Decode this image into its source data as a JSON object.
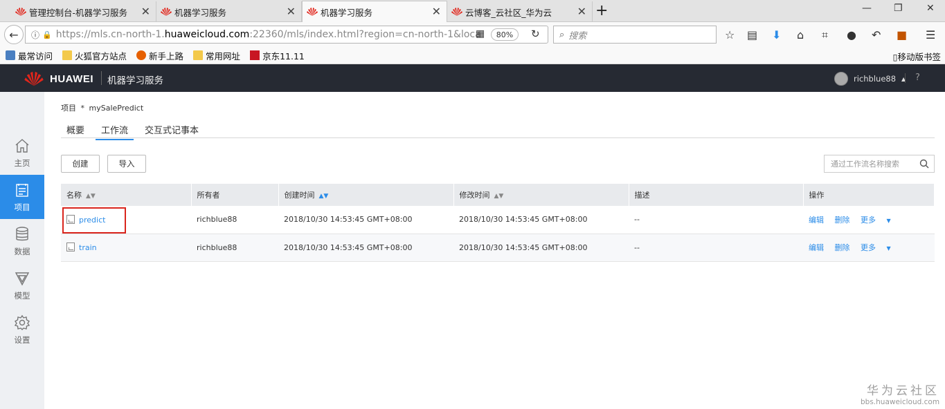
{
  "browser": {
    "tabs": [
      {
        "label": "管理控制台-机器学习服务",
        "active": false
      },
      {
        "label": "机器学习服务",
        "active": false
      },
      {
        "label": "机器学习服务",
        "active": true
      },
      {
        "label": "云博客_云社区_华为云",
        "active": false
      }
    ],
    "url_prefix": "https://mls.cn-north-1.",
    "url_host": "huaweicloud.com",
    "url_suffix": ":22360/mls/index.html?region=cn-north-1&loca",
    "zoom": "80%",
    "search_placeholder": "搜索",
    "bookmarks": [
      "最常访问",
      "火狐官方站点",
      "新手上路",
      "常用网址",
      "京东11.11"
    ],
    "mobile_bookmarks": "移动版书签"
  },
  "app": {
    "brand": "HUAWEI",
    "service_title": "机器学习服务",
    "username": "richblue88",
    "help": "?"
  },
  "sidebar": {
    "items": [
      {
        "label": "主页",
        "icon": "home-icon"
      },
      {
        "label": "项目",
        "icon": "project-icon",
        "active": true
      },
      {
        "label": "数据",
        "icon": "database-icon"
      },
      {
        "label": "模型",
        "icon": "model-icon"
      },
      {
        "label": "设置",
        "icon": "gear-icon"
      }
    ]
  },
  "main": {
    "breadcrumb_root": "项目",
    "breadcrumb_sep": "*",
    "breadcrumb_current": "mySalePredict",
    "tabs": [
      {
        "label": "概要"
      },
      {
        "label": "工作流",
        "active": true
      },
      {
        "label": "交互式记事本"
      }
    ],
    "create_label": "创建",
    "import_label": "导入",
    "search_placeholder": "通过工作流名称搜索",
    "table": {
      "headers": [
        "名称",
        "所有者",
        "创建时间",
        "修改时间",
        "描述",
        "操作"
      ],
      "rows": [
        {
          "name": "predict",
          "owner": "richblue88",
          "created": "2018/10/30 14:53:45 GMT+08:00",
          "modified": "2018/10/30 14:53:45 GMT+08:00",
          "desc": "--"
        },
        {
          "name": "train",
          "owner": "richblue88",
          "created": "2018/10/30 14:53:45 GMT+08:00",
          "modified": "2018/10/30 14:53:45 GMT+08:00",
          "desc": "--"
        }
      ],
      "ops": {
        "edit": "编辑",
        "delete": "删除",
        "more": "更多"
      }
    }
  },
  "watermark": {
    "title": "华为云社区",
    "site": "bbs.huaweicloud.com"
  }
}
